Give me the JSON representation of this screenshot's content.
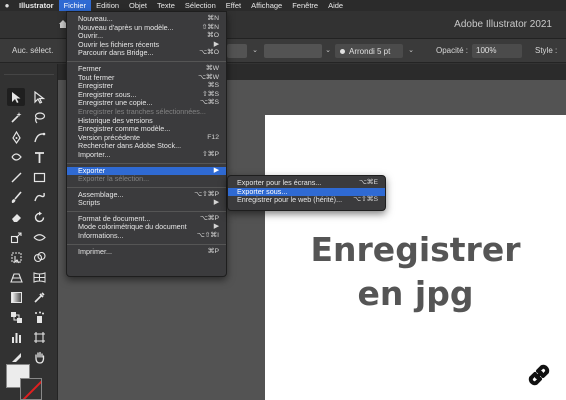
{
  "menubar": {
    "app": "Illustrator",
    "items": [
      "Fichier",
      "Edition",
      "Objet",
      "Texte",
      "Sélection",
      "Effet",
      "Affichage",
      "Fenêtre",
      "Aide"
    ],
    "active": "Fichier"
  },
  "titlebar": {
    "title": "Adobe Illustrator 2021"
  },
  "controlbar": {
    "selection_label": "Auc. sélect.",
    "stroke_style": "Arrondi 5 pt",
    "opacity_label": "Opacité :",
    "opacity_value": "100%",
    "style_label": "Style :"
  },
  "file_menu": {
    "group1": [
      {
        "label": "Nouveau...",
        "shortcut": "⌘N"
      },
      {
        "label": "Nouveau d'après un modèle...",
        "shortcut": "⇧⌘N"
      },
      {
        "label": "Ouvrir...",
        "shortcut": "⌘O"
      },
      {
        "label": "Ouvrir les fichiers récents",
        "shortcut": "▶"
      },
      {
        "label": "Parcourir dans Bridge...",
        "shortcut": "⌥⌘O"
      }
    ],
    "group2": [
      {
        "label": "Fermer",
        "shortcut": "⌘W"
      },
      {
        "label": "Tout fermer",
        "shortcut": "⌥⌘W"
      },
      {
        "label": "Enregistrer",
        "shortcut": "⌘S"
      },
      {
        "label": "Enregistrer sous...",
        "shortcut": "⇧⌘S"
      },
      {
        "label": "Enregistrer une copie...",
        "shortcut": "⌥⌘S"
      },
      {
        "label": "Enregistrer les tranches sélectionnées...",
        "shortcut": ""
      },
      {
        "label": "Historique des versions",
        "shortcut": ""
      },
      {
        "label": "Enregistrer comme modèle...",
        "shortcut": ""
      },
      {
        "label": "Version précédente",
        "shortcut": "F12"
      },
      {
        "label": "Rechercher dans Adobe Stock...",
        "shortcut": ""
      },
      {
        "label": "Importer...",
        "shortcut": "⇧⌘P"
      }
    ],
    "group3": [
      {
        "label": "Exporter",
        "shortcut": "▶"
      },
      {
        "label": "Exporter la sélection...",
        "shortcut": ""
      }
    ],
    "group4": [
      {
        "label": "Assemblage...",
        "shortcut": "⌥⇧⌘P"
      },
      {
        "label": "Scripts",
        "shortcut": "▶"
      }
    ],
    "group5": [
      {
        "label": "Format de document...",
        "shortcut": "⌥⌘P"
      },
      {
        "label": "Mode colorimétrique du document",
        "shortcut": "▶"
      },
      {
        "label": "Informations...",
        "shortcut": "⌥⇧⌘I"
      }
    ],
    "group6": [
      {
        "label": "Imprimer...",
        "shortcut": "⌘P"
      }
    ]
  },
  "export_submenu": [
    {
      "label": "Exporter pour les écrans...",
      "shortcut": "⌥⌘E"
    },
    {
      "label": "Exporter sous...",
      "shortcut": ""
    },
    {
      "label": "Enregistrer pour le web (hérité)...",
      "shortcut": "⌥⇧⌘S"
    }
  ],
  "artboard": {
    "line1": "Enregistrer",
    "line2": "en jpg"
  },
  "icons": [
    "apple-icon",
    "home-icon",
    "selection-tool-icon",
    "direct-selection-tool-icon",
    "magic-wand-icon",
    "lasso-icon",
    "pen-icon",
    "curvature-icon",
    "type-icon",
    "line-icon",
    "rectangle-icon",
    "paintbrush-icon",
    "pencil-icon",
    "eraser-icon",
    "rotate-icon",
    "scale-icon",
    "width-icon",
    "free-transform-icon",
    "shape-builder-icon",
    "perspective-icon",
    "mesh-icon",
    "gradient-icon",
    "eyedropper-icon",
    "blend-icon",
    "symbol-sprayer-icon",
    "graph-icon",
    "artboard-icon",
    "slice-icon",
    "hand-icon",
    "zoom-icon",
    "link-badge-icon"
  ],
  "colors": {
    "menu_highlight": "#2f6ad3",
    "headline": "#555555",
    "menu_bg": "#3b3b3d"
  }
}
